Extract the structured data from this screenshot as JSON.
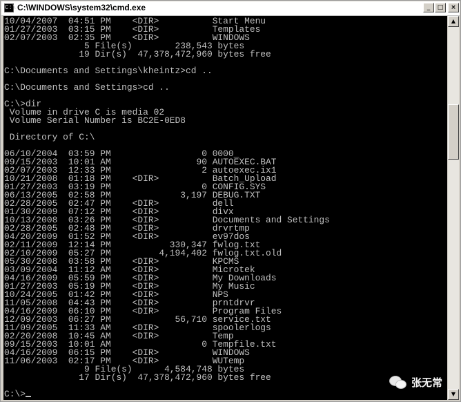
{
  "window": {
    "title": "C:\\WINDOWS\\system32\\cmd.exe",
    "icon_label": "C:\\",
    "buttons": {
      "minimize": "_",
      "maximize": "□",
      "close": "×"
    }
  },
  "console": {
    "lines": [
      "10/04/2007  04:51 PM    <DIR>          Start Menu",
      "01/27/2003  03:15 PM    <DIR>          Templates",
      "02/07/2003  02:35 PM    <DIR>          WINDOWS",
      "               5 File(s)        238,543 bytes",
      "              19 Dir(s)  47,378,472,960 bytes free",
      "",
      "C:\\Documents and Settings\\kheintz>cd ..",
      "",
      "C:\\Documents and Settings>cd ..",
      "",
      "C:\\>dir",
      " Volume in drive C is media 02",
      " Volume Serial Number is BC2E-0ED8",
      "",
      " Directory of C:\\",
      "",
      "06/10/2004  03:59 PM                 0 0000_",
      "09/15/2003  10:01 AM                90 AUTOEXEC.BAT",
      "02/07/2003  12:33 PM                 2 autoexec.ix1",
      "10/21/2008  01:18 PM    <DIR>          Batch_Upload",
      "01/27/2003  03:19 PM                 0 CONFIG.SYS",
      "06/13/2005  02:58 PM             3,197 DEBUG.TXT",
      "02/28/2005  02:47 PM    <DIR>          dell",
      "01/30/2009  07:12 PM    <DIR>          divx",
      "10/13/2008  03:26 PM    <DIR>          Documents and Settings",
      "02/28/2005  02:48 PM    <DIR>          drvrtmp",
      "04/20/2009  01:52 PM    <DIR>          ev97dos",
      "02/11/2009  12:14 PM           330,347 fwlog.txt",
      "02/10/2009  05:27 PM         4,194,402 fwlog.txt.old",
      "05/30/2008  03:58 PM    <DIR>          KPCMS",
      "03/09/2004  11:12 AM    <DIR>          Microtek",
      "04/16/2009  05:59 PM    <DIR>          My Downloads",
      "01/27/2003  05:19 PM    <DIR>          My Music",
      "10/24/2005  01:42 PM    <DIR>          NPS",
      "11/05/2008  04:43 PM    <DIR>          prntdrvr",
      "04/16/2009  06:10 PM    <DIR>          Program Files",
      "12/09/2003  06:27 PM            56,710 service.txt",
      "11/09/2005  11:33 AM    <DIR>          spoolerlogs",
      "02/20/2008  10:45 AM    <DIR>          Temp",
      "09/15/2003  10:01 AM                 0 Tempfile.txt",
      "04/16/2009  06:15 PM    <DIR>          WINDOWS",
      "11/06/2003  02:17 PM    <DIR>          WUTemp",
      "               9 File(s)      4,584,748 bytes",
      "              17 Dir(s)  47,378,472,960 bytes free",
      ""
    ],
    "prompt": "C:\\>",
    "colors": {
      "background": "#000000",
      "text": "#c0c0c0"
    }
  },
  "scrollbar": {
    "up_arrow": "▲",
    "down_arrow": "▼"
  },
  "watermark": {
    "text": "张无常"
  }
}
